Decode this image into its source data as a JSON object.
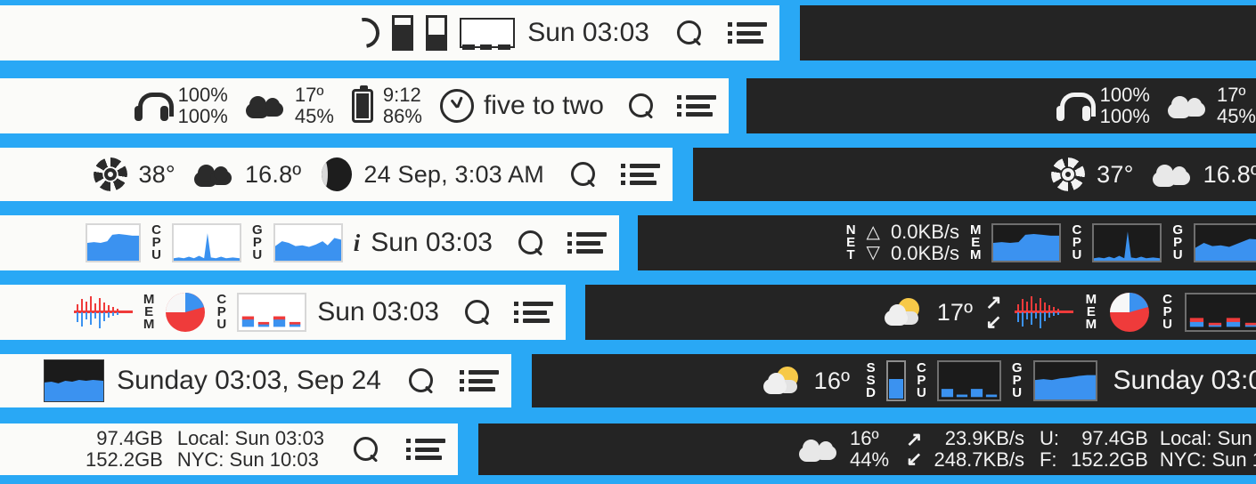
{
  "theme": {
    "background": "#29a8f5",
    "light_bar_bg": "#fbfbf9",
    "dark_bar_bg": "#242424",
    "light_text": "#2b2b2b",
    "dark_text": "#f2f2f2",
    "graph_blue": "#3b92f0",
    "graph_red": "#ef3b3b",
    "sun_yellow": "#f7c948"
  },
  "rows": [
    {
      "id": "row-1",
      "light": {
        "icons": [
          "arc-spinner-icon",
          "battery-block-icon",
          "battery-block-small-icon",
          "dashed-bars-widget"
        ],
        "clock": "Sun 03:03",
        "search_icon": "search-icon",
        "menu_icon": "list-menu-icon"
      },
      "dark": {
        "content": ""
      }
    },
    {
      "id": "row-2",
      "light": {
        "headphones_icon": "headphones-icon",
        "headphones_top": "100%",
        "headphones_bottom": "100%",
        "weather_icon": "cloud-icon",
        "weather_temp": "17º",
        "weather_humidity": "45%",
        "battery_icon": "battery-icon",
        "battery_time": "9:12",
        "battery_pct": "86%",
        "clock_icon": "analog-clock-icon",
        "clock_words": "five to two",
        "search_icon": "search-icon",
        "menu_icon": "list-menu-icon"
      },
      "dark": {
        "headphones_icon": "headphones-icon",
        "headphones_top": "100%",
        "headphones_bottom": "100%",
        "weather_icon": "cloud-icon",
        "weather_temp": "17º",
        "weather_humidity": "45%"
      }
    },
    {
      "id": "row-3",
      "light": {
        "fan_icon": "sun-flower-icon",
        "fan_value": "38°",
        "weather_icon": "cloud-icon",
        "weather_value": "16.8º",
        "moon_icon": "moon-phase-icon",
        "date": "24 Sep, 3:03 AM",
        "search_icon": "search-icon",
        "menu_icon": "list-menu-icon"
      },
      "dark": {
        "fan_icon": "sun-flower-icon",
        "fan_value": "37°",
        "weather_icon": "cloud-icon",
        "weather_value": "16.8º"
      }
    },
    {
      "id": "row-4",
      "light": {
        "mem_graph": "memory-area-graph",
        "cpu_label": "CPU",
        "cpu_graph": "cpu-spike-graph",
        "gpu_label": "GPU",
        "gpu_graph": "gpu-area-graph",
        "info_icon": "info-italic-icon",
        "clock": "Sun 03:03",
        "search_icon": "search-icon",
        "menu_icon": "list-menu-icon"
      },
      "dark": {
        "net_label": "NET",
        "net_up": "0.0KB/s",
        "net_down": "0.0KB/s",
        "mem_label": "MEM",
        "mem_graph": "memory-area-graph",
        "cpu_label": "CPU",
        "cpu_graph": "cpu-spike-graph",
        "gpu_label": "GPU",
        "gpu_graph": "gpu-area-graph"
      }
    },
    {
      "id": "row-5",
      "light": {
        "wave_icon": "audio-waveform-graph",
        "mem_label": "MEM",
        "pie_icon": "memory-pie-chart",
        "cpu_label": "CPU",
        "cpu_graph": "cpu-bar-graph",
        "clock": "Sun 03:03",
        "search_icon": "search-icon",
        "menu_icon": "list-menu-icon"
      },
      "dark": {
        "weather_icon": "sun-behind-cloud-icon",
        "weather_temp": "17º",
        "net_icon": "network-arrows-icon",
        "wave_icon": "audio-waveform-graph",
        "mem_label": "MEM",
        "pie_icon": "memory-pie-chart",
        "cpu_label": "CPU",
        "cpu_graph": "cpu-bar-graph"
      }
    },
    {
      "id": "row-6",
      "light": {
        "graph": "memory-dark-area-graph",
        "clock": "Sunday 03:03, Sep 24",
        "search_icon": "search-icon",
        "menu_icon": "list-menu-icon"
      },
      "dark": {
        "weather_icon": "sun-behind-cloud-icon",
        "weather_temp": "16º",
        "ssd_label": "SSD",
        "ssd_gauge": "ssd-vertical-gauge",
        "cpu_label": "CPU",
        "cpu_graph": "cpu-bar-graph",
        "gpu_label": "GPU",
        "gpu_graph": "gpu-area-graph",
        "clock": "Sunday 03:0"
      }
    },
    {
      "id": "row-7",
      "light": {
        "disk_used": "97.4GB",
        "disk_free": "152.2GB",
        "time_local": "Local: Sun 03:03",
        "time_nyc": "NYC: Sun 10:03",
        "search_icon": "search-icon",
        "menu_icon": "list-menu-icon"
      },
      "dark": {
        "weather_icon": "cloud-icon",
        "weather_temp": "16º",
        "weather_humidity": "44%",
        "net_icon": "network-arrows-icon",
        "net_up": "23.9KB/s",
        "net_down": "248.7KB/s",
        "disk_used_label": "U:",
        "disk_free_label": "F:",
        "disk_used": "97.4GB",
        "disk_free": "152.2GB",
        "time_local": "Local: Sun ",
        "time_nyc": "NYC: Sun 1"
      }
    }
  ]
}
